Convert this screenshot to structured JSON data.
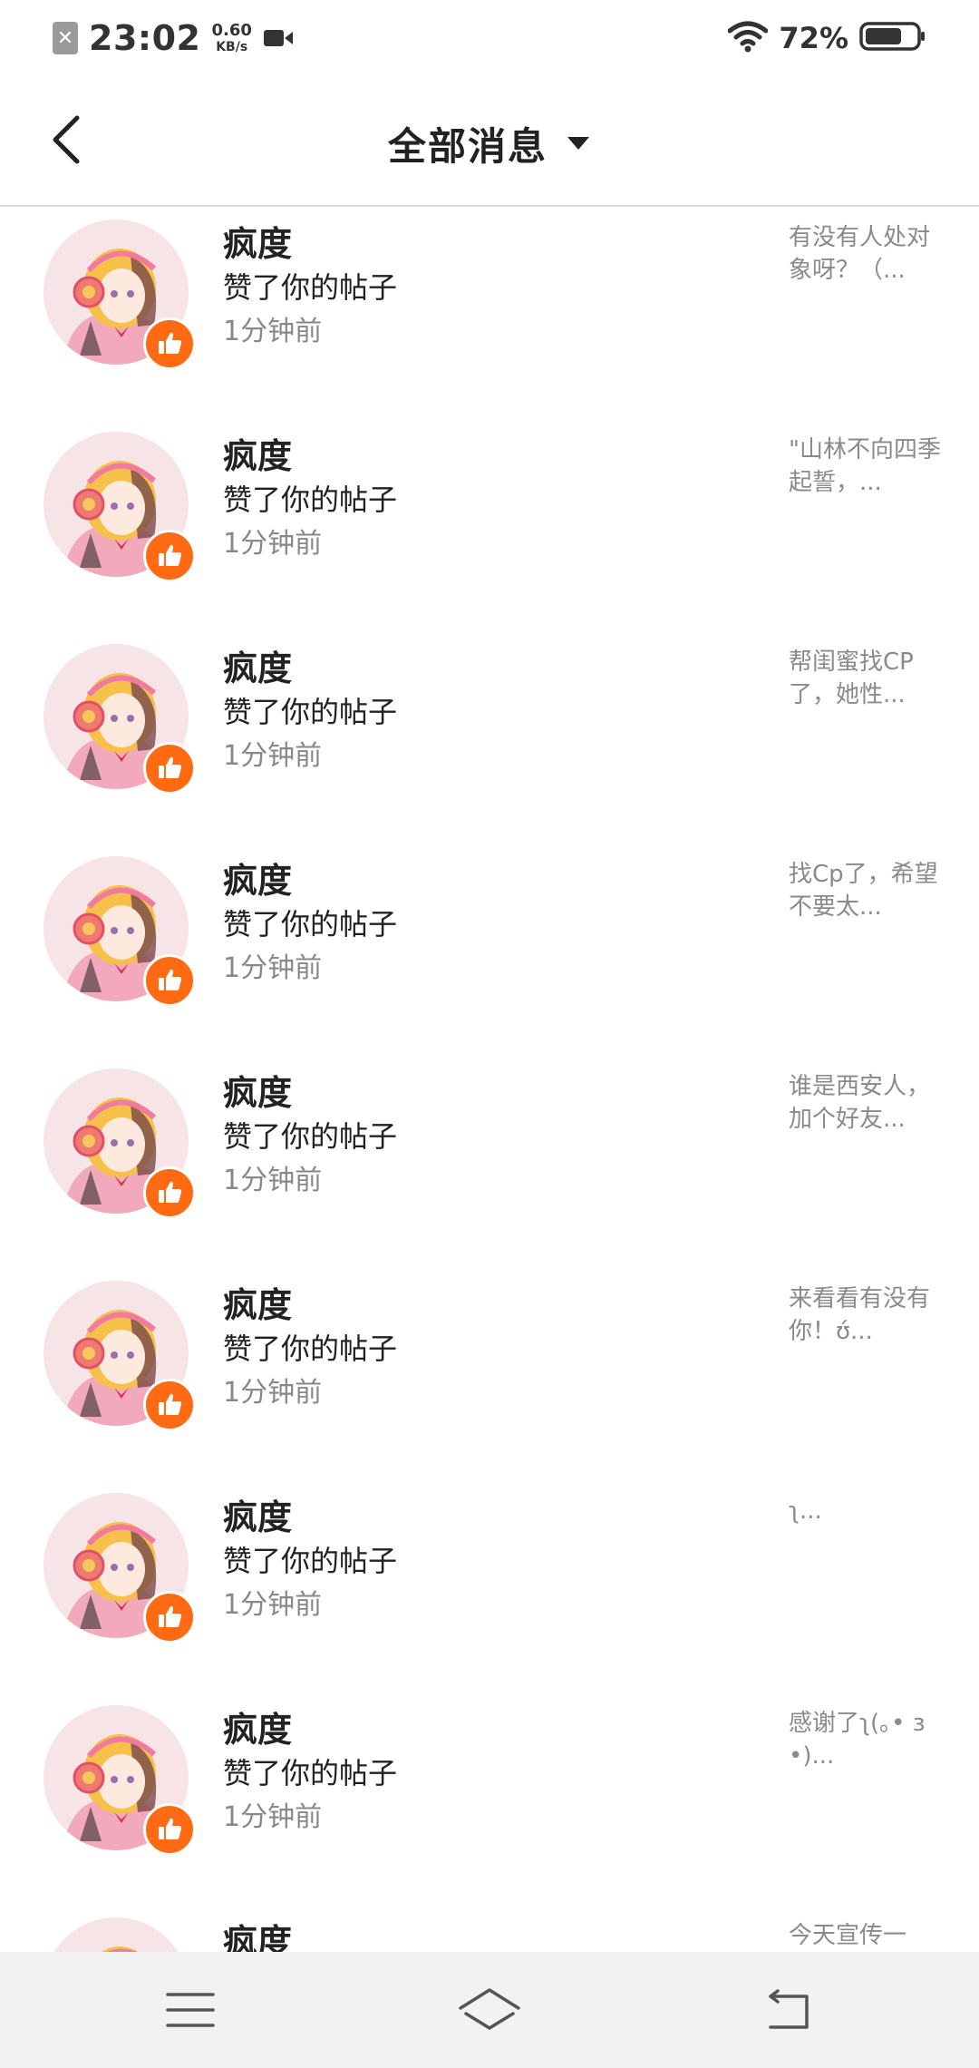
{
  "status_bar": {
    "time": "23:02",
    "net_speed_value": "0.60",
    "net_speed_unit": "KB/s",
    "battery_percent": "72%",
    "battery_level": 0.72,
    "icons": [
      "sim-off-icon",
      "video-record-icon",
      "wifi-icon",
      "battery-icon"
    ]
  },
  "header": {
    "title": "全部消息",
    "back_icon": "chevron-left-icon",
    "dropdown_icon": "caret-down-icon"
  },
  "colors": {
    "accent": "#ff6a13",
    "text_primary": "#222222",
    "text_secondary": "#888888",
    "divider": "#dcdcdc",
    "nav_background": "#f2f2f2"
  },
  "messages": [
    {
      "name": "疯度",
      "action": "赞了你的帖子",
      "time": "1分钟前",
      "preview": "有没有人处对象呀？（..."
    },
    {
      "name": "疯度",
      "action": "赞了你的帖子",
      "time": "1分钟前",
      "preview": "\"山林不向四季起誓，..."
    },
    {
      "name": "疯度",
      "action": "赞了你的帖子",
      "time": "1分钟前",
      "preview": "帮闺蜜找CP了，她性..."
    },
    {
      "name": "疯度",
      "action": "赞了你的帖子",
      "time": "1分钟前",
      "preview": "找Cp了，希望不要太..."
    },
    {
      "name": "疯度",
      "action": "赞了你的帖子",
      "time": "1分钟前",
      "preview": "谁是西安人，加个好友..."
    },
    {
      "name": "疯度",
      "action": "赞了你的帖子",
      "time": "1分钟前",
      "preview": "来看看有没有你！ʊ́..."
    },
    {
      "name": "疯度",
      "action": "赞了你的帖子",
      "time": "1分钟前",
      "preview": "ʅ..."
    },
    {
      "name": "疯度",
      "action": "赞了你的帖子",
      "time": "1分钟前",
      "preview": "感谢了ʅ(｡• з•)..."
    },
    {
      "name": "疯度",
      "action": "",
      "time": "",
      "preview": "今天宣传一"
    }
  ],
  "bottom_nav": {
    "icons": [
      "menu-icon",
      "home-icon",
      "back-icon"
    ]
  }
}
